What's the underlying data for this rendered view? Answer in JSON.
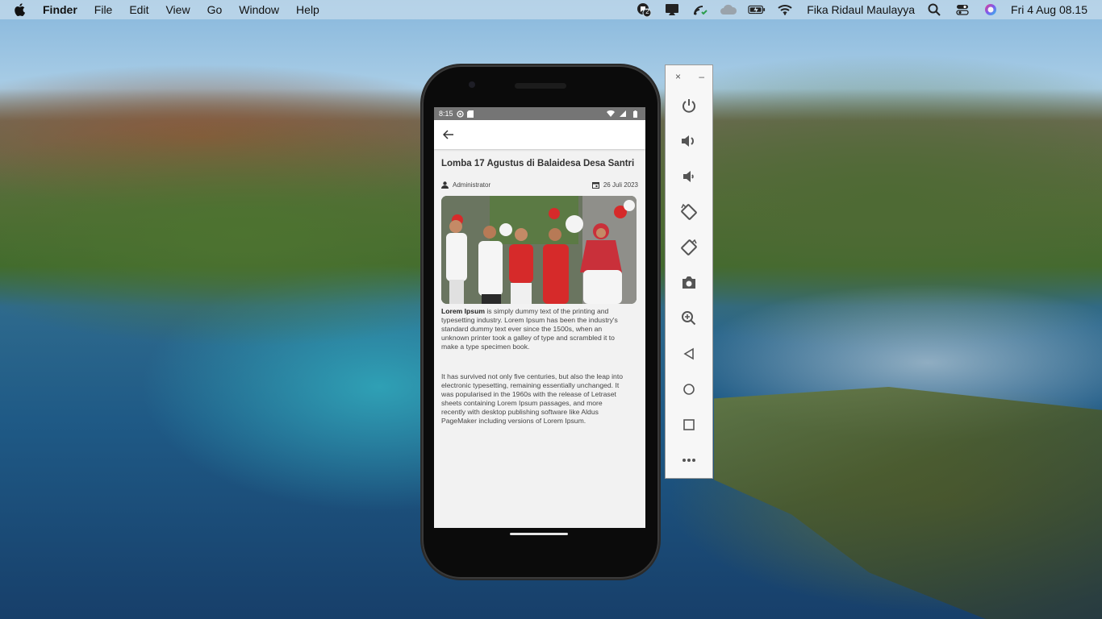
{
  "menubar": {
    "app_name": "Finder",
    "menus": [
      "File",
      "Edit",
      "View",
      "Go",
      "Window",
      "Help"
    ],
    "notification_count": "2",
    "user_name": "Fika Ridaul Maulayya",
    "clock": "Fri 4 Aug  08.15"
  },
  "phone": {
    "status_bar": {
      "time": "8:15"
    },
    "article": {
      "title": "Lomba 17 Agustus di Balaidesa Desa Santri",
      "author": "Administrator",
      "date": "26 Juli 2023",
      "para1_bold": "Lorem Ipsum",
      "para1_rest": " is simply dummy text of the printing and typesetting industry. Lorem Ipsum has been the industry's standard dummy text ever since the 1500s, when an unknown printer took a galley of type and scrambled it to make a type specimen book.",
      "para2": "It has survived not only five centuries, but also the leap into electronic typesetting, remaining essentially unchanged. It was popularised in the 1960s with the release of Letraset sheets containing Lorem Ipsum passages, and more recently with desktop publishing software like Aldus PageMaker including versions of Lorem Ipsum."
    }
  },
  "emulator_toolbar": {
    "close_glyph": "×",
    "minimize_glyph": "–",
    "tools": [
      "power-icon",
      "volume-up-icon",
      "volume-down-icon",
      "rotate-left-icon",
      "rotate-right-icon",
      "camera-icon",
      "zoom-icon",
      "back-icon",
      "home-icon",
      "overview-icon",
      "more-icon"
    ]
  },
  "colors": {
    "accent_blue": "#1a73e8",
    "phone_body": "#0b0b0b",
    "status_bar": "#757575",
    "jersey_red": "#d62a2a"
  }
}
